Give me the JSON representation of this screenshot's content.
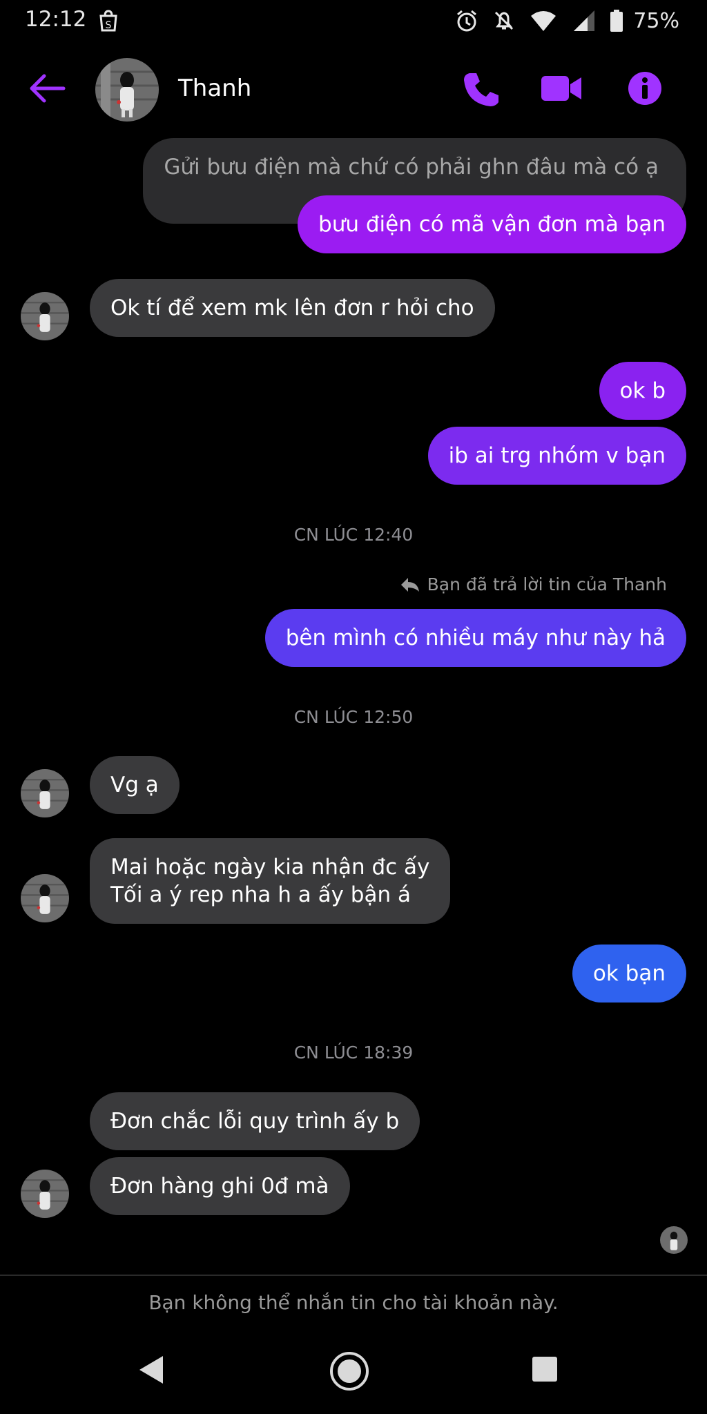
{
  "status_bar": {
    "time": "12:12",
    "battery": "75%",
    "icons": [
      "shopee-bag-icon",
      "alarm-icon",
      "mute-icon",
      "wifi-icon",
      "signal-icon",
      "battery-icon"
    ]
  },
  "header": {
    "contact_name": "Thanh",
    "icons": [
      "back-arrow-icon",
      "phone-icon",
      "video-icon",
      "info-icon"
    ],
    "accent_color": "#a033ff"
  },
  "messages": [
    {
      "id": "m1",
      "direction": "out-quoted",
      "text": "Gửi bưu điện mà chứ có phải ghn đâu mà có ạ"
    },
    {
      "id": "m2",
      "direction": "out",
      "text": "bưu điện có mã vận đơn mà bạn",
      "color": "#9b1cf2"
    },
    {
      "id": "m3",
      "direction": "in",
      "text": "Ok tí để xem mk lên đơn r hỏi cho"
    },
    {
      "id": "m4",
      "direction": "out",
      "text": "ok b",
      "color": "#8a22f0"
    },
    {
      "id": "m5",
      "direction": "out",
      "text": "ib ai trg nhóm v bạn",
      "color": "#7c2bef"
    },
    {
      "id": "m6",
      "direction": "out",
      "text": "bên mình có nhiều máy như này hả",
      "color": "#5b3cf0"
    },
    {
      "id": "m7",
      "direction": "in",
      "text": "Vg ạ"
    },
    {
      "id": "m8",
      "direction": "in",
      "line1": "Mai hoặc ngày kia nhận đc ấy",
      "line2": "Tối a ý rep nha h a ấy bận á"
    },
    {
      "id": "m9",
      "direction": "out",
      "text": "ok bạn",
      "color": "#2f62ef"
    },
    {
      "id": "m10",
      "direction": "in",
      "text": "Đơn chắc lỗi quy trình ấy b"
    },
    {
      "id": "m11",
      "direction": "in",
      "text": "Đơn hàng ghi 0đ mà"
    }
  ],
  "timestamps": {
    "t1": "CN LÚC 12:40",
    "t2": "CN LÚC 12:50",
    "t3": "CN LÚC 18:39"
  },
  "reply_note": "Bạn đã trả lời tin của Thanh",
  "footer_note": "Bạn không thể nhắn tin cho tài khoản này.",
  "nav_icons": [
    "back-triangle-icon",
    "home-circle-icon",
    "recents-square-icon"
  ]
}
